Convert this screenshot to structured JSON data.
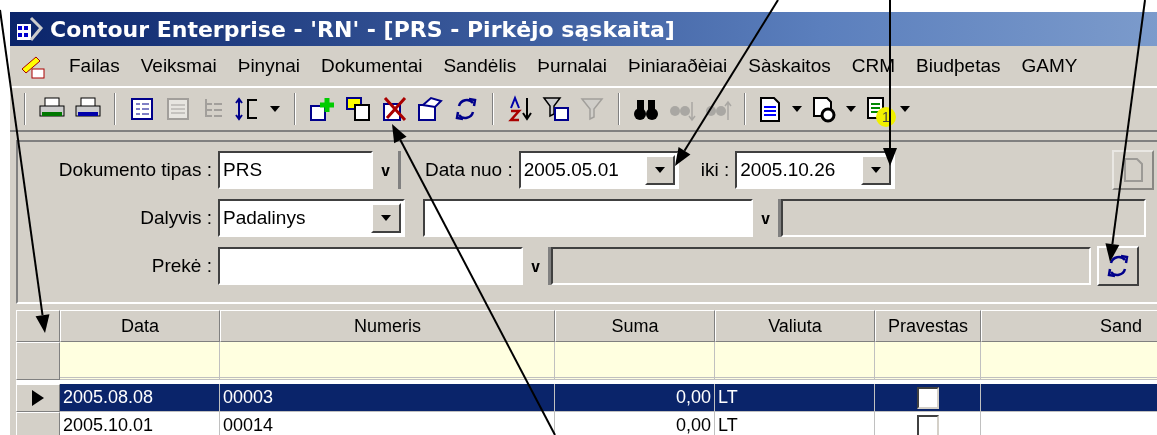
{
  "window": {
    "title": "Contour Enterprise - 'RN' - [PRS - Pirkėjo sąskaita]"
  },
  "menu": [
    "Failas",
    "Veiksmai",
    "Þinynai",
    "Dokumentai",
    "Sandėlis",
    "Þurnalai",
    "Þiniaraðèiai",
    "Sàskaitos",
    "CRM",
    "Biudþetas",
    "GAMY"
  ],
  "toolbar": [
    [
      {
        "disabled": false,
        "dropdown": false
      },
      {
        "disabled": false,
        "dropdown": false
      }
    ],
    [
      {
        "disabled": false,
        "dropdown": false
      },
      {
        "disabled": true,
        "dropdown": false
      },
      {
        "disabled": true,
        "dropdown": false
      },
      {
        "disabled": false,
        "dropdown": true
      }
    ],
    [
      {
        "disabled": false,
        "dropdown": false
      },
      {
        "disabled": false,
        "dropdown": false
      },
      {
        "disabled": false,
        "dropdown": false
      },
      {
        "disabled": false,
        "dropdown": false
      },
      {
        "disabled": false,
        "dropdown": false
      }
    ],
    [
      {
        "disabled": false,
        "dropdown": false
      },
      {
        "disabled": false,
        "dropdown": false
      },
      {
        "disabled": true,
        "dropdown": false
      }
    ],
    [
      {
        "disabled": false,
        "dropdown": false
      },
      {
        "disabled": true,
        "dropdown": false
      },
      {
        "disabled": true,
        "dropdown": false
      }
    ],
    [
      {
        "disabled": false,
        "dropdown": true
      },
      {
        "disabled": false,
        "dropdown": true
      },
      {
        "disabled": false,
        "dropdown": true,
        "badge": "1"
      }
    ]
  ],
  "filters": {
    "document_type": {
      "label": "Dokumento tipas :",
      "value": "PRS",
      "button": "v"
    },
    "date_from": {
      "label": "Data nuo :",
      "value": "2005.05.01"
    },
    "date_to": {
      "label": "iki :",
      "value": "2005.10.26"
    },
    "new_button": {
      "disabled": true
    },
    "participant": {
      "label": "Dalyvis :",
      "value": "Padalinys",
      "button": "v"
    },
    "item": {
      "label": "Prekė :",
      "button": "v"
    }
  },
  "table": {
    "columns": [
      "Data",
      "Numeris",
      "Suma",
      "Valiuta",
      "Pravestas",
      "Sand"
    ],
    "rows": [
      {
        "selected": true,
        "cells": [
          "2005.08.08",
          "00003",
          "0,00",
          "LT"
        ],
        "posted": false
      },
      {
        "selected": false,
        "cells": [
          "2005.10.01",
          "00014",
          "0,00",
          "LT"
        ],
        "posted": false
      }
    ]
  }
}
